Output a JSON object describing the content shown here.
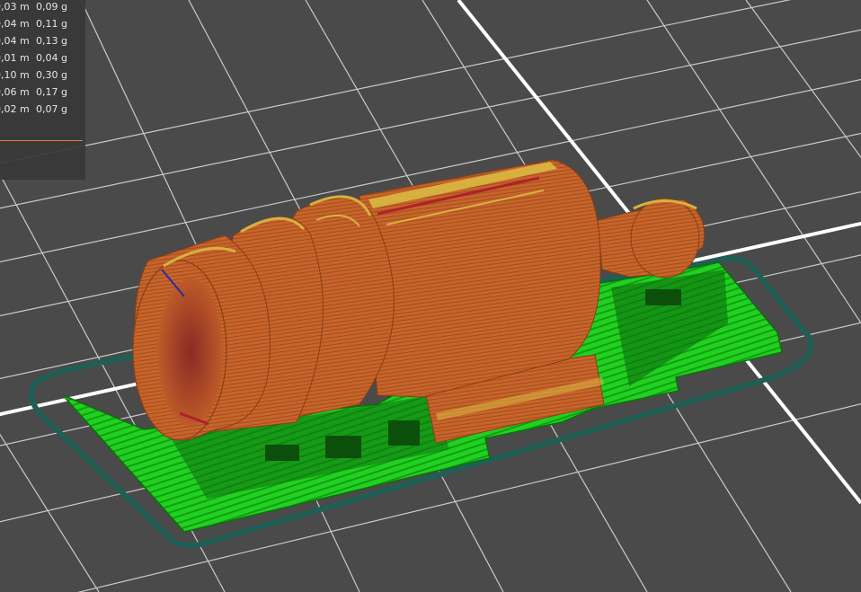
{
  "colors": {
    "background": "#4a4a4a",
    "grid_minor": "#dcdcdc",
    "grid_major": "#ffffff",
    "skirt": "#1f5f55",
    "support": "#22d022",
    "support_dark": "#0e6e0e",
    "perimeter": "#c8642a",
    "perimeter_highlight": "#d8b040",
    "infill": "#b0202a",
    "accent_line": "#e8773a"
  },
  "legend": {
    "rows": [
      {
        "length": "0,03 m",
        "weight": "0,09 g"
      },
      {
        "length": "0,04 m",
        "weight": "0,11 g"
      },
      {
        "length": "0,04 m",
        "weight": "0,13 g"
      },
      {
        "length": "0,01 m",
        "weight": "0,04 g"
      },
      {
        "length": "0,10 m",
        "weight": "0,30 g"
      },
      {
        "length": "0,06 m",
        "weight": "0,17 g"
      },
      {
        "length": "0,02 m",
        "weight": "0,07 g"
      }
    ]
  }
}
